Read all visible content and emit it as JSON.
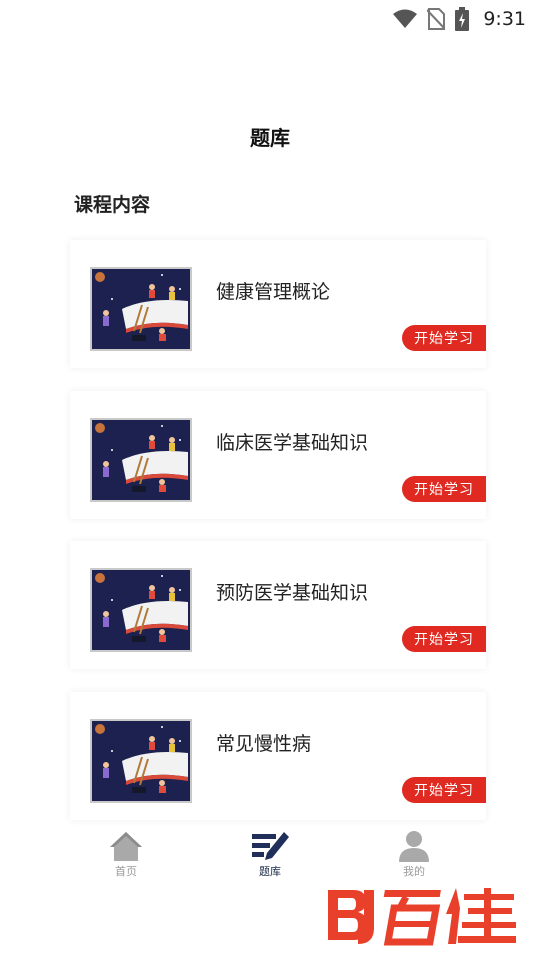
{
  "status_bar": {
    "time": "9:31",
    "icons": [
      "wifi-icon",
      "no-sim-icon",
      "battery-charging-icon"
    ]
  },
  "header": {
    "title": "题库"
  },
  "section": {
    "title": "课程内容"
  },
  "courses": [
    {
      "name": "健康管理概论",
      "button_label": "开始学习"
    },
    {
      "name": "临床医学基础知识",
      "button_label": "开始学习"
    },
    {
      "name": "预防医学基础知识",
      "button_label": "开始学习"
    },
    {
      "name": "常见慢性病",
      "button_label": "开始学习"
    }
  ],
  "bottom_nav": {
    "items": [
      {
        "label": "首页",
        "icon": "home-icon",
        "active": false
      },
      {
        "label": "题库",
        "icon": "question-bank-icon",
        "active": true
      },
      {
        "label": "我的",
        "icon": "user-icon",
        "active": false
      }
    ]
  },
  "colors": {
    "accent_red": "#e02a21",
    "nav_active": "#1f2f5a",
    "nav_inactive": "#9a9a9a"
  },
  "watermark": {
    "text": "百佳"
  }
}
